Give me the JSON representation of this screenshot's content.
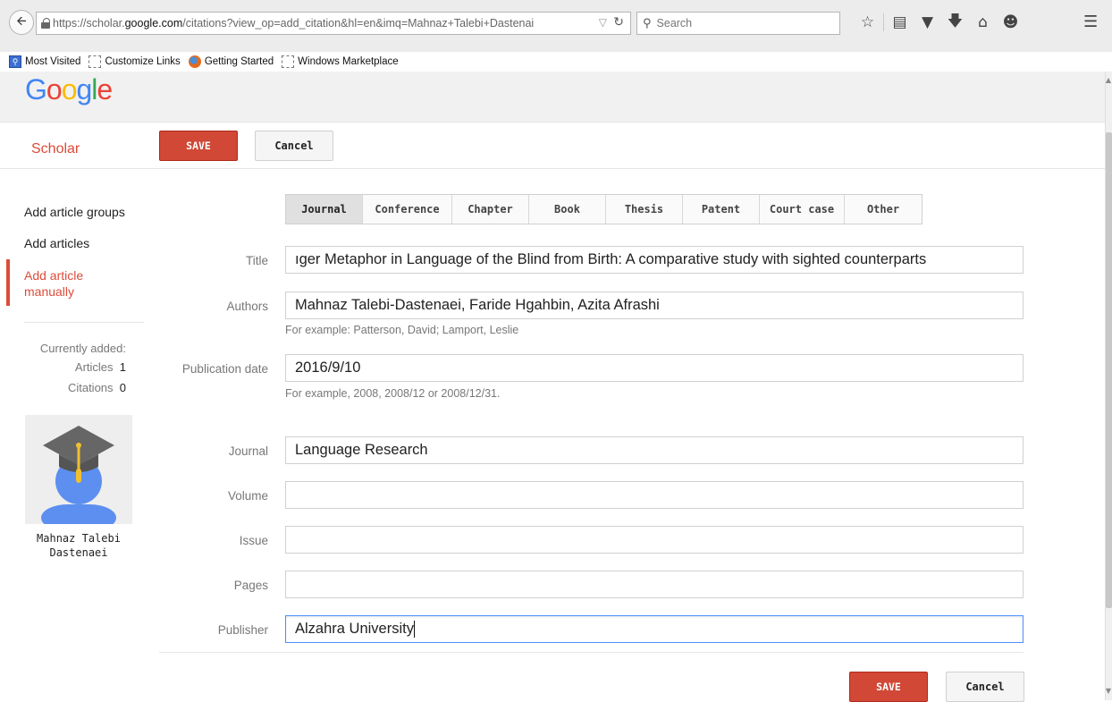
{
  "browser": {
    "url_prefix": "https://scholar.",
    "url_domain": "google.com",
    "url_rest": "/citations?view_op=add_citation&hl=en&imq=Mahnaz+Talebi+Dastenai",
    "search_placeholder": "Search",
    "bookmarks": [
      {
        "label": "Most Visited"
      },
      {
        "label": "Customize Links"
      },
      {
        "label": "Getting Started"
      },
      {
        "label": "Windows Marketplace"
      }
    ]
  },
  "header": {
    "logo_letters": [
      "G",
      "o",
      "o",
      "g",
      "l",
      "e"
    ],
    "section": "Scholar",
    "save_label": "SAVE",
    "cancel_label": "Cancel"
  },
  "sidebar": {
    "items": [
      {
        "label": "Add article groups"
      },
      {
        "label": "Add articles"
      },
      {
        "label": "Add article"
      },
      {
        "label": "manually"
      }
    ],
    "currently_added_label": "Currently added:",
    "articles_label": "Articles",
    "articles_count": "1",
    "citations_label": "Citations",
    "citations_count": "0",
    "user_name_line1": "Mahnaz Talebi",
    "user_name_line2": "Dastenaei"
  },
  "tabs": [
    {
      "label": "Journal"
    },
    {
      "label": "Conference"
    },
    {
      "label": "Chapter"
    },
    {
      "label": "Book"
    },
    {
      "label": "Thesis"
    },
    {
      "label": "Patent"
    },
    {
      "label": "Court case"
    },
    {
      "label": "Other"
    }
  ],
  "form": {
    "title_label": "Title",
    "title_value": "ıger Metaphor in Language of the Blind from Birth: A comparative study with sighted counterparts",
    "authors_label": "Authors",
    "authors_value": "Mahnaz Talebi-Dastenaei, Faride Hgahbin, Azita Afrashi",
    "authors_hint": "For example: Patterson, David; Lamport, Leslie",
    "date_label": "Publication date",
    "date_value": "2016/9/10",
    "date_hint": "For example, 2008, 2008/12 or 2008/12/31.",
    "journal_label": "Journal",
    "journal_value": "Language Research",
    "volume_label": "Volume",
    "volume_value": "",
    "issue_label": "Issue",
    "issue_value": "",
    "pages_label": "Pages",
    "pages_value": "",
    "publisher_label": "Publisher",
    "publisher_value": "Alzahra University"
  },
  "footer": {
    "save_label": "SAVE",
    "cancel_label": "Cancel"
  },
  "colors": {
    "accent_red": "#dd4b39",
    "save_button": "#d14836",
    "focus_blue": "#4d90fe"
  }
}
